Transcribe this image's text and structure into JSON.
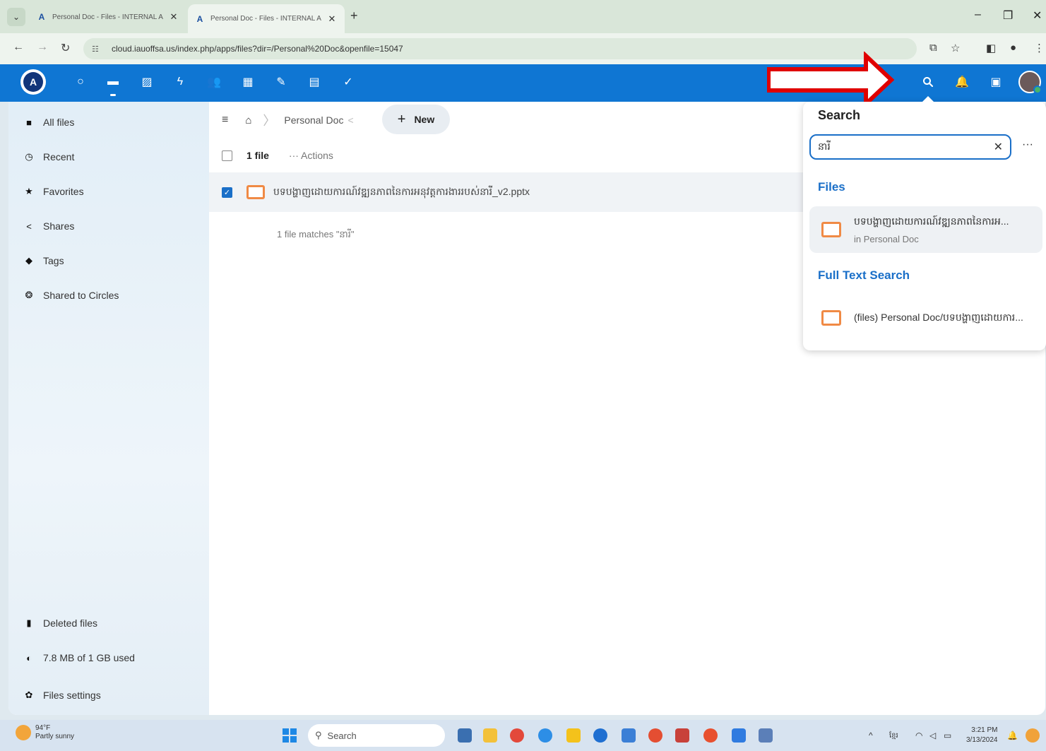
{
  "browser": {
    "tabs": [
      {
        "title": "Personal Doc - Files - INTERNAL A",
        "active": false
      },
      {
        "title": "Personal Doc - Files - INTERNAL A",
        "active": true
      }
    ],
    "url": "cloud.iauoffsa.us/index.php/apps/files?dir=/Personal%20Doc&openfile=15047"
  },
  "sidebar": {
    "items": [
      {
        "label": "All files",
        "icon": "folder-icon"
      },
      {
        "label": "Recent",
        "icon": "clock-icon"
      },
      {
        "label": "Favorites",
        "icon": "star-icon"
      },
      {
        "label": "Shares",
        "icon": "share-icon"
      },
      {
        "label": "Tags",
        "icon": "tag-icon"
      },
      {
        "label": "Shared to Circles",
        "icon": "circles-icon"
      }
    ],
    "deleted_files": "Deleted files",
    "quota": "7.8 MB of 1 GB used",
    "settings": "Files settings"
  },
  "breadcrumb": {
    "folder": "Personal Doc",
    "new_label": "New"
  },
  "file_list": {
    "count": "1 file",
    "actions": "Actions",
    "files": [
      {
        "name": "បទបង្ហាញដោយការណ៍វឌ្ឍនភាពនៃការអនុវត្តការងាររបស់នារី_v2.pptx",
        "selected": true
      }
    ],
    "matches_text": "1 file matches \"នារី\""
  },
  "search": {
    "title": "Search",
    "query": "នារី",
    "files_heading": "Files",
    "file_result": {
      "name": "បទបង្ហាញដោយការណ៍វឌ្ឍនភាពនៃការអ...",
      "location": "in Personal Doc"
    },
    "fulltext_heading": "Full Text Search",
    "fulltext_result": "(files) Personal Doc/បទបង្ហាញដោយការ..."
  },
  "taskbar": {
    "temp": "94°F",
    "weather": "Partly sunny",
    "search_placeholder": "Search",
    "lang": "ខ្មែរ",
    "time": "3:21 PM",
    "date": "3/13/2024"
  },
  "colors": {
    "header": "#0f76d3",
    "accent": "#1a6fc8",
    "pptx": "#f08a45",
    "annotation_arrow": "#e00000"
  }
}
